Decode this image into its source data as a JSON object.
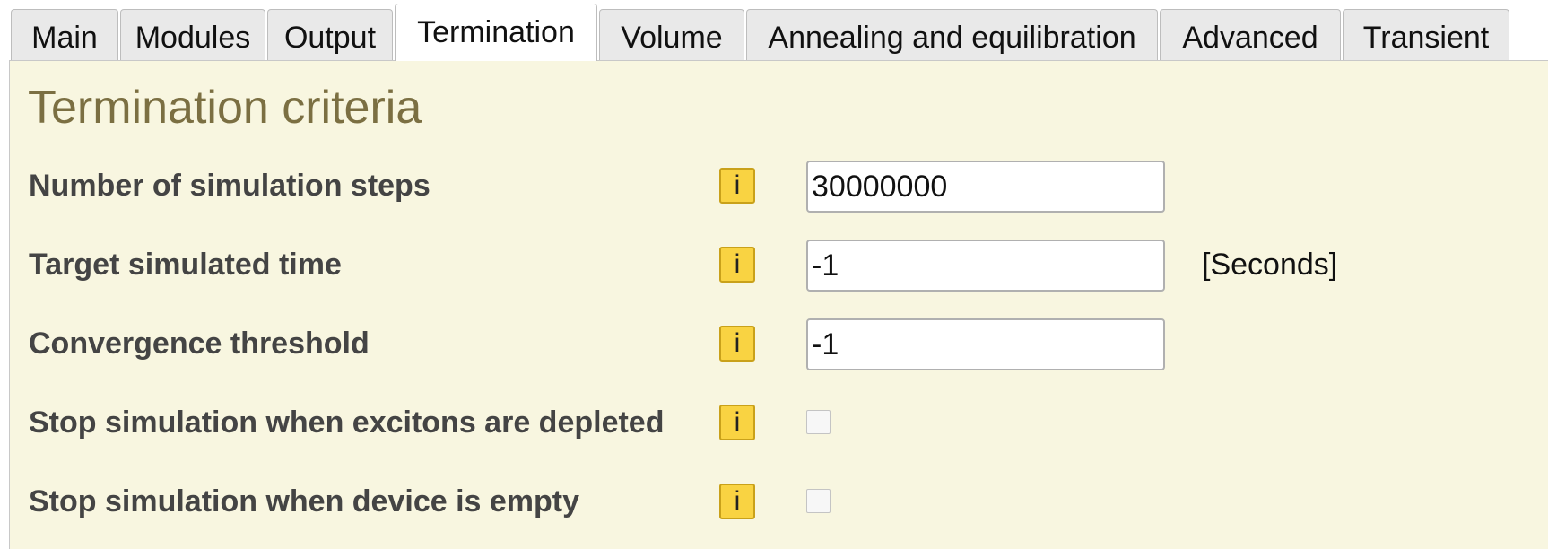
{
  "tabs": [
    {
      "label": "Main",
      "active": false
    },
    {
      "label": "Modules",
      "active": false
    },
    {
      "label": "Output",
      "active": false
    },
    {
      "label": "Termination",
      "active": true
    },
    {
      "label": "Volume",
      "active": false
    },
    {
      "label": "Annealing and equilibration",
      "active": false
    },
    {
      "label": "Advanced",
      "active": false
    },
    {
      "label": "Transient",
      "active": false
    }
  ],
  "section": {
    "title": "Termination criteria",
    "info_glyph": "i",
    "rows": [
      {
        "label": "Number of simulation steps",
        "value": "30000000"
      },
      {
        "label": "Target simulated time",
        "value": "-1",
        "unit": "[Seconds]"
      },
      {
        "label": "Convergence threshold",
        "value": "-1"
      },
      {
        "label": "Stop simulation when excitons are depleted",
        "checked": false
      },
      {
        "label": "Stop simulation when device is empty",
        "checked": false
      }
    ]
  },
  "colors": {
    "panel_background": "#f8f6e0",
    "section_title": "#7b6f42",
    "info_button": "#f9d342",
    "tab_inactive": "#e9e9e9",
    "tab_active": "#ffffff"
  }
}
